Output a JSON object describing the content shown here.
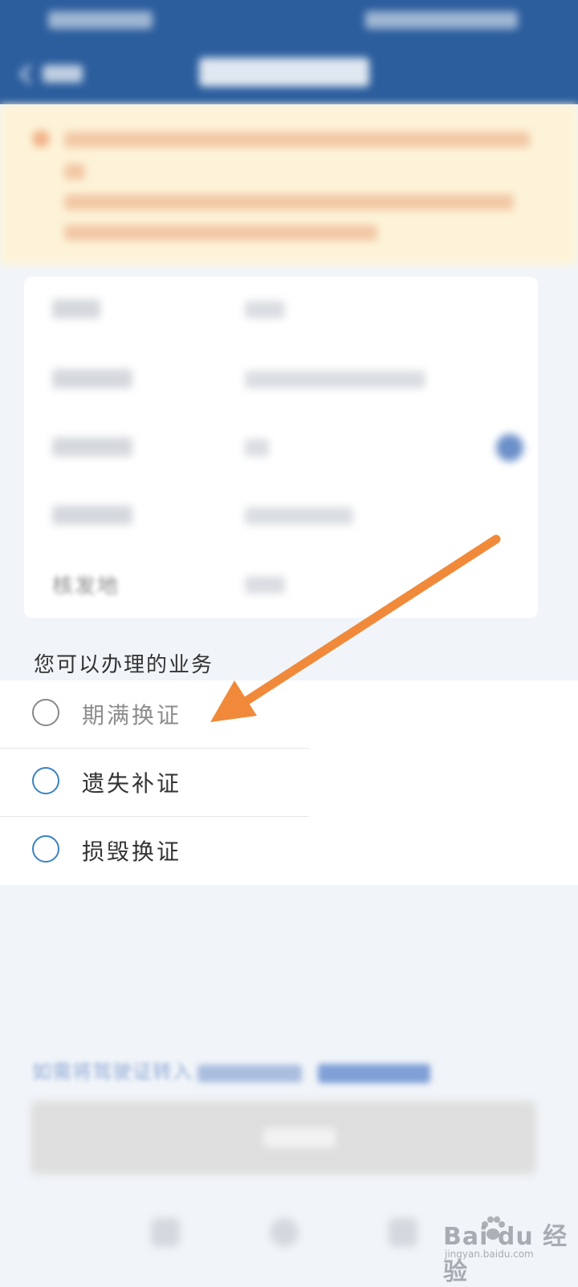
{
  "info_card": {
    "issuing_place_label": "核发地"
  },
  "services": {
    "title": "您可以办理的业务",
    "options": [
      {
        "label": "期满换证",
        "state": "disabled"
      },
      {
        "label": "遗失补证",
        "state": "enabled"
      },
      {
        "label": "损毁换证",
        "state": "enabled"
      }
    ]
  },
  "footer": {
    "hint_text": "如需将驾驶证转入"
  },
  "watermark": {
    "brand": "Bai du 经验",
    "sub": "jingyan.baidu.com"
  },
  "colors": {
    "header": "#2c5e9e",
    "notice_bg": "#fdf3d8",
    "radio_active": "#3a82c0",
    "annotation_arrow": "#f08a3a"
  },
  "icons": [
    "back-chevron-icon",
    "info-circle-icon",
    "radio-icon",
    "arrow-annotation-icon",
    "baidu-paw-icon"
  ]
}
